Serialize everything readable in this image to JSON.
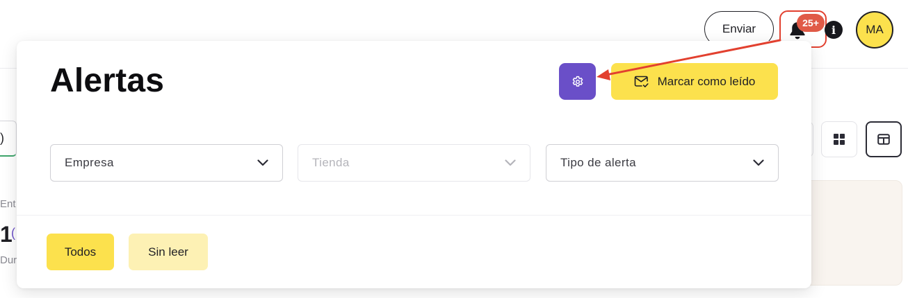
{
  "header": {
    "send_label": "Enviar",
    "notification_badge": "25+",
    "avatar_initials": "MA"
  },
  "background": {
    "search_fragment": ")",
    "stat_label": "Ent",
    "stat_value": "1",
    "stat_extra": "(",
    "stat_sub": "Dur"
  },
  "alerts": {
    "title": "Alertas",
    "mark_read_label": "Marcar como leído",
    "filters": {
      "company_placeholder": "Empresa",
      "store_placeholder": "Tienda",
      "type_placeholder": "Tipo de alerta"
    },
    "tabs": {
      "all": "Todos",
      "unread": "Sin leer"
    }
  },
  "colors": {
    "accent_yellow": "#fce14d",
    "light_yellow": "#fdf1b4",
    "settings_purple": "#6a4fc8",
    "badge_red": "#e05a47",
    "annotation_red": "#e2402f"
  },
  "icons": [
    "bell-icon",
    "info-icon",
    "gear-icon",
    "mail-check-icon",
    "chevron-down-icon",
    "grid-view-icon",
    "table-view-icon"
  ]
}
